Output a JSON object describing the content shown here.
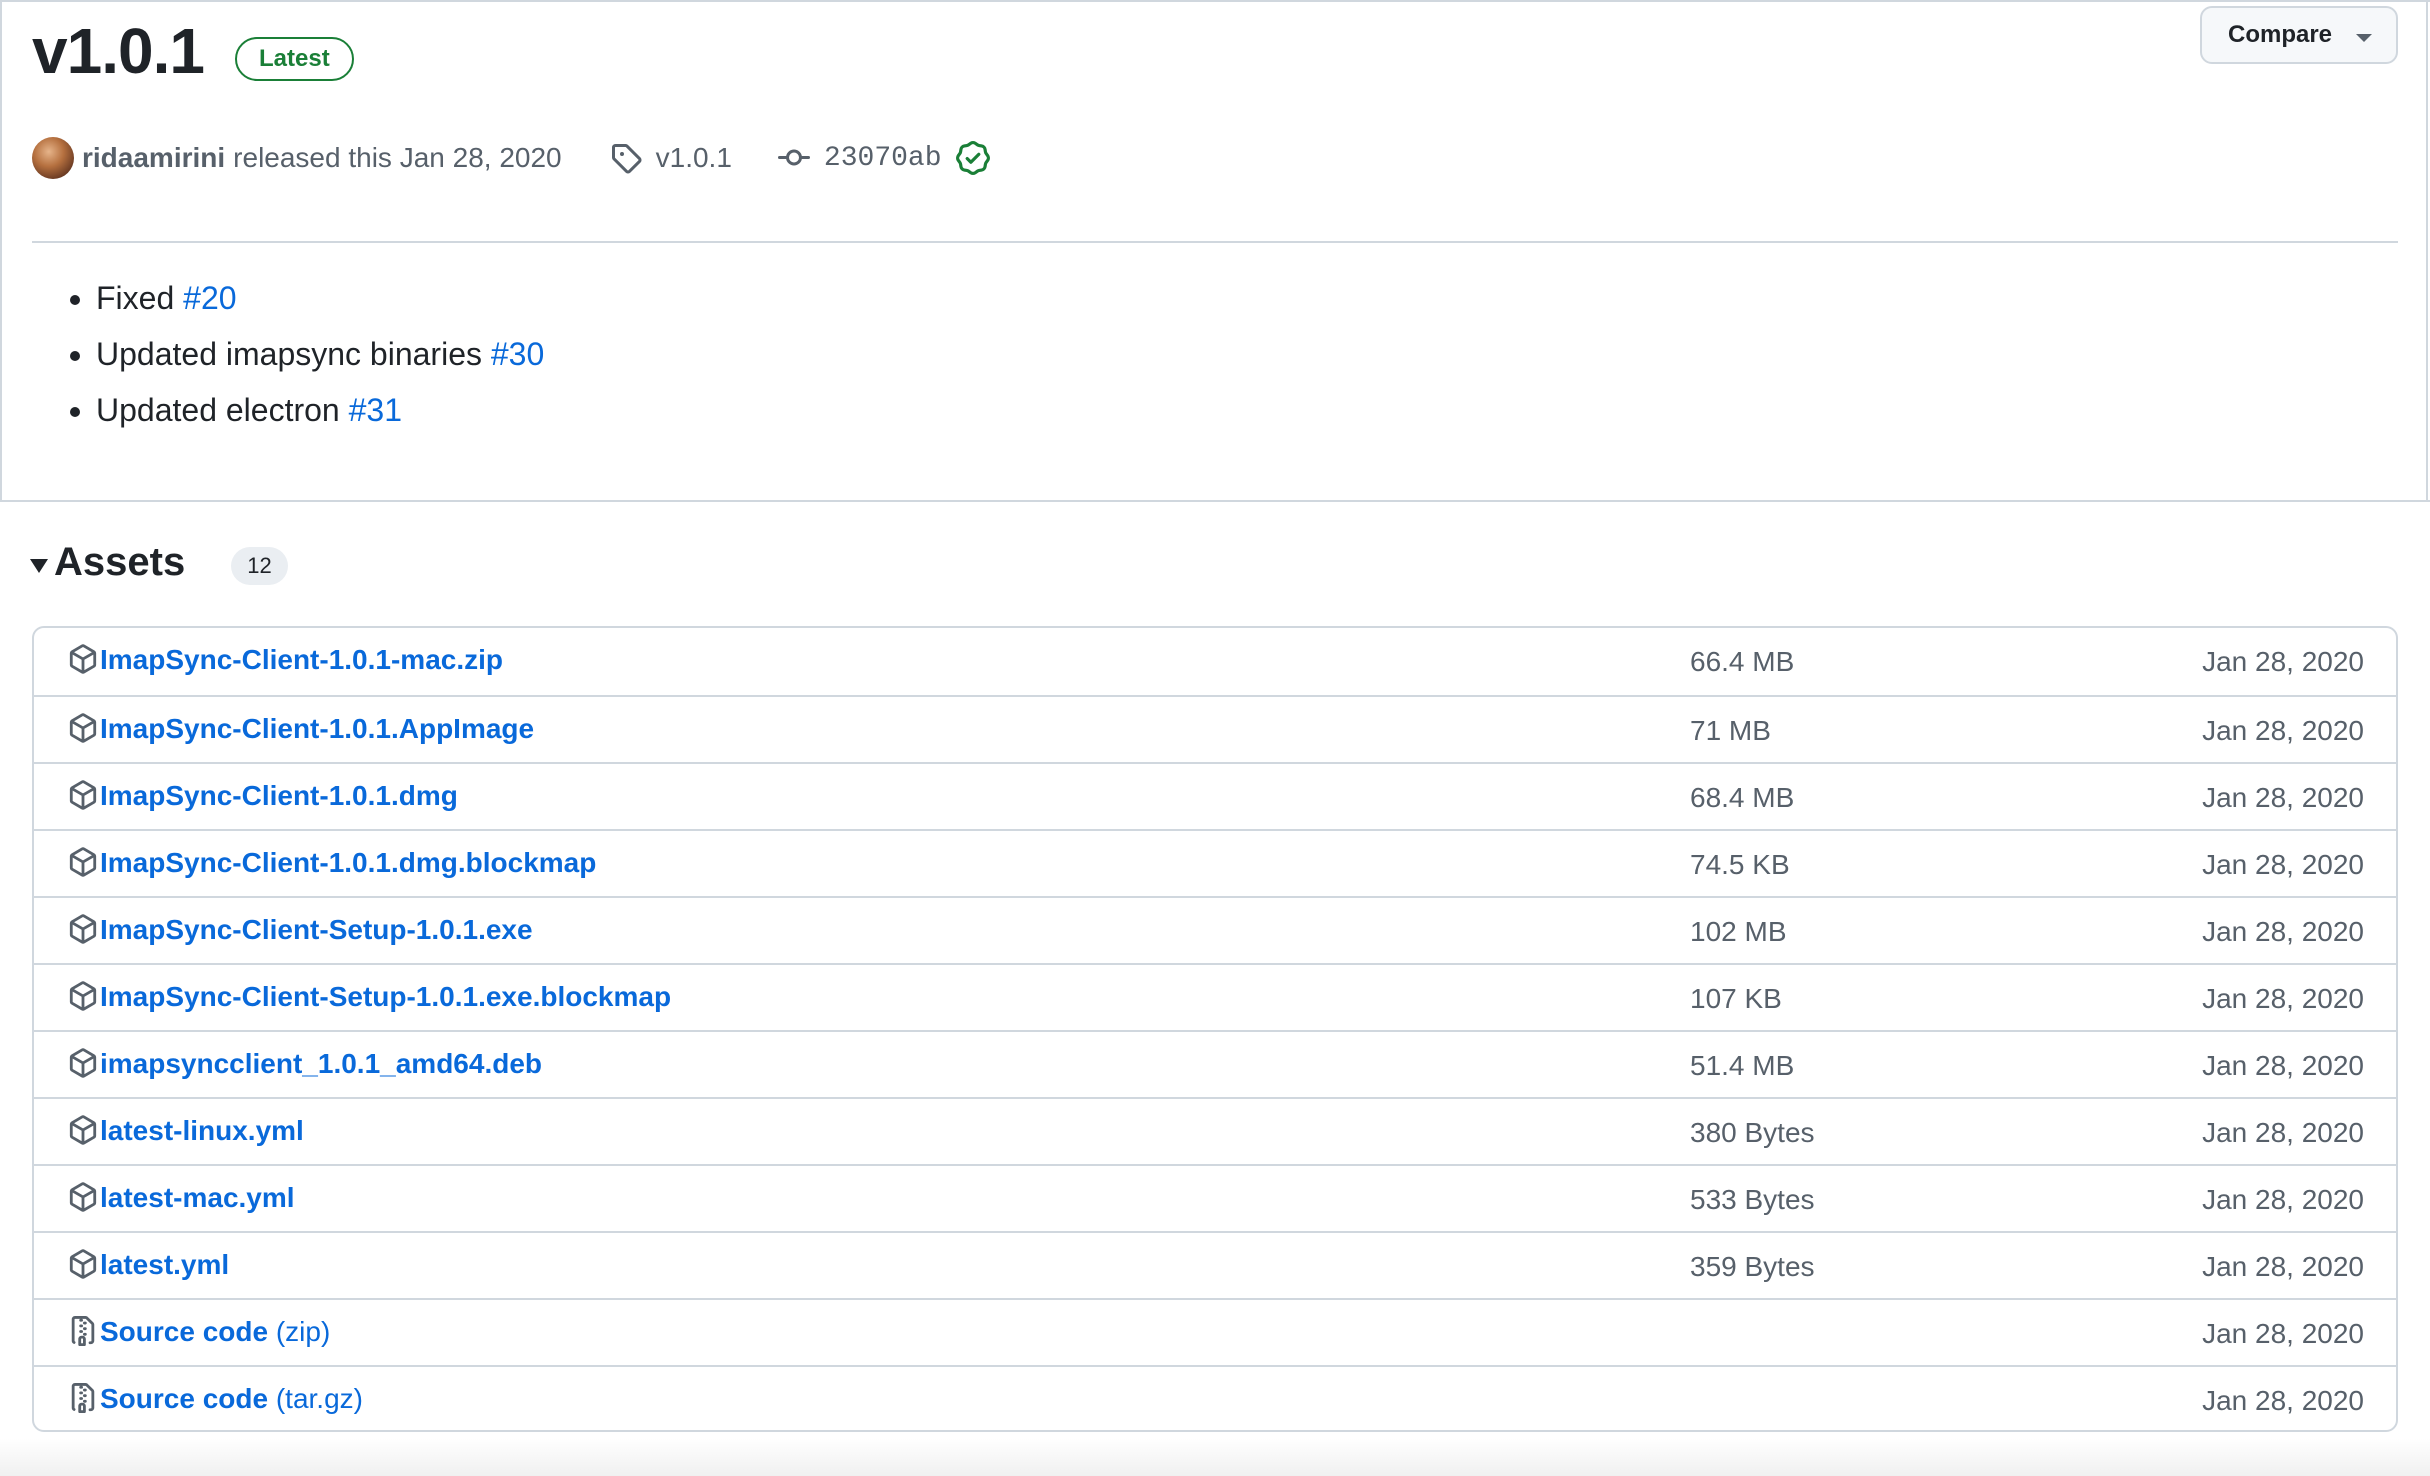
{
  "release": {
    "title": "v1.0.1",
    "badge": "Latest",
    "compare_label": "Compare",
    "author": "ridaamirini",
    "released_text": "released this Jan 28, 2020",
    "tag": "v1.0.1",
    "commit": "23070ab"
  },
  "notes": [
    {
      "text": "Fixed ",
      "link": "#20"
    },
    {
      "text": "Updated imapsync binaries ",
      "link": "#30"
    },
    {
      "text": "Updated electron ",
      "link": "#31"
    }
  ],
  "assets": {
    "label": "Assets",
    "count": "12",
    "rows": [
      {
        "icon": "package-icon",
        "name": "ImapSync-Client-1.0.1-mac.zip",
        "suffix": "",
        "size": "66.4 MB",
        "date": "Jan 28, 2020"
      },
      {
        "icon": "package-icon",
        "name": "ImapSync-Client-1.0.1.AppImage",
        "suffix": "",
        "size": "71 MB",
        "date": "Jan 28, 2020"
      },
      {
        "icon": "package-icon",
        "name": "ImapSync-Client-1.0.1.dmg",
        "suffix": "",
        "size": "68.4 MB",
        "date": "Jan 28, 2020"
      },
      {
        "icon": "package-icon",
        "name": "ImapSync-Client-1.0.1.dmg.blockmap",
        "suffix": "",
        "size": "74.5 KB",
        "date": "Jan 28, 2020"
      },
      {
        "icon": "package-icon",
        "name": "ImapSync-Client-Setup-1.0.1.exe",
        "suffix": "",
        "size": "102 MB",
        "date": "Jan 28, 2020"
      },
      {
        "icon": "package-icon",
        "name": "ImapSync-Client-Setup-1.0.1.exe.blockmap",
        "suffix": "",
        "size": "107 KB",
        "date": "Jan 28, 2020"
      },
      {
        "icon": "package-icon",
        "name": "imapsyncclient_1.0.1_amd64.deb",
        "suffix": "",
        "size": "51.4 MB",
        "date": "Jan 28, 2020"
      },
      {
        "icon": "package-icon",
        "name": "latest-linux.yml",
        "suffix": "",
        "size": "380 Bytes",
        "date": "Jan 28, 2020"
      },
      {
        "icon": "package-icon",
        "name": "latest-mac.yml",
        "suffix": "",
        "size": "533 Bytes",
        "date": "Jan 28, 2020"
      },
      {
        "icon": "package-icon",
        "name": "latest.yml",
        "suffix": "",
        "size": "359 Bytes",
        "date": "Jan 28, 2020"
      },
      {
        "icon": "file-zip-icon",
        "name": "Source code",
        "suffix": " (zip)",
        "size": "",
        "date": "Jan 28, 2020"
      },
      {
        "icon": "file-zip-icon",
        "name": "Source code",
        "suffix": " (tar.gz)",
        "size": "",
        "date": "Jan 28, 2020"
      }
    ]
  },
  "colors": {
    "link": "#0969da",
    "latest_green": "#1a7f37",
    "border": "#d0d7de",
    "muted": "#57606a"
  }
}
